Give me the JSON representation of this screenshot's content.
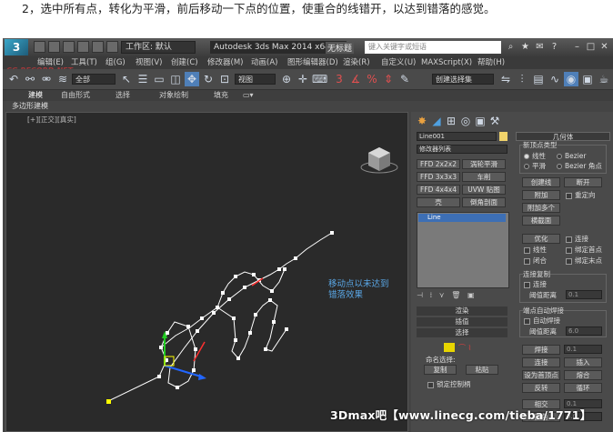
{
  "caption": "2，选中所有点，转化为平滑，前后移动一下点的位置，使重合的线错开，以达到错落的感觉。",
  "titlebar": {
    "workspace": "工作区: 默认",
    "app_title": "Autodesk 3ds Max  2014 x64",
    "unnamed": "无标题",
    "search_placeholder": "键入关键字或短语"
  },
  "watermark": "CG RECORD.NET",
  "menu": [
    "编辑(E)",
    "工具(T)",
    "组(G)",
    "视图(V)",
    "创建(C)",
    "修改器(M)",
    "动画(A)",
    "图形编辑器(D)",
    "渲染(R)",
    "自定义(U)",
    "MAXScript(X)",
    "帮助(H)"
  ],
  "toolbar": {
    "filter": "全部",
    "refcoord": "视图",
    "selection_set": "创建选择集"
  },
  "ribbon": {
    "tabs": [
      "建模",
      "自由形式",
      "选择",
      "对象绘制",
      "填充"
    ],
    "sub": "多边形建模"
  },
  "viewport": {
    "label": "[+][正交][真实]",
    "annotation_line1": "移动点以未达到",
    "annotation_line2": "错落效果"
  },
  "panel": {
    "object_name": "Line001",
    "modifier_list": "修改器列表",
    "buttons": [
      "FFD 2x2x2",
      "涡轮平滑",
      "FFD 3x3x3",
      "车削",
      "FFD 4x4x4",
      "UVW 贴图",
      "壳",
      "倒角剖面"
    ],
    "stack_item": "Line",
    "sections": {
      "render": "渲染",
      "interp": "插值",
      "select": "选择"
    },
    "named_sel": "命名选择:",
    "copy": "复制",
    "paste": "粘贴",
    "lock_handles": "锁定控制柄",
    "geometry": {
      "title": "几何体",
      "new_vertex_type": "新顶点类型",
      "linear": "线性",
      "bezier": "Bezier",
      "smooth": "平滑",
      "bezier_corner": "Bezier 角点",
      "create_line": "创建线",
      "break": "断开",
      "attach": "附加",
      "reorient": "重定向",
      "attach_mult": "附加多个",
      "cross_section": "横截面",
      "optimize": "优化",
      "connect": "连接",
      "linear2": "线性",
      "bind_first": "绑定首点",
      "closed": "闭合",
      "bind_last": "绑定末点",
      "connect_copy": "连接复制",
      "connect2": "连接",
      "threshold": "阈值距离",
      "threshold_val": "0.1",
      "end_auto_weld": "端点自动焊接",
      "auto_weld": "自动焊接",
      "threshold2": "阈值距离",
      "threshold2_val": "6.0",
      "weld": "焊接",
      "weld_val": "0.1",
      "connect3": "连接",
      "insert": "插入",
      "make_first": "设为首顶点",
      "fuse": "熔合",
      "reverse": "反转",
      "cycle": "循环",
      "cross": "相交",
      "cross_val": "0.1",
      "fillet": "圆角",
      "fillet_val": "0.0"
    }
  },
  "footer_watermark": "3Dmax吧【www.linecg.com/tieba/1771】"
}
